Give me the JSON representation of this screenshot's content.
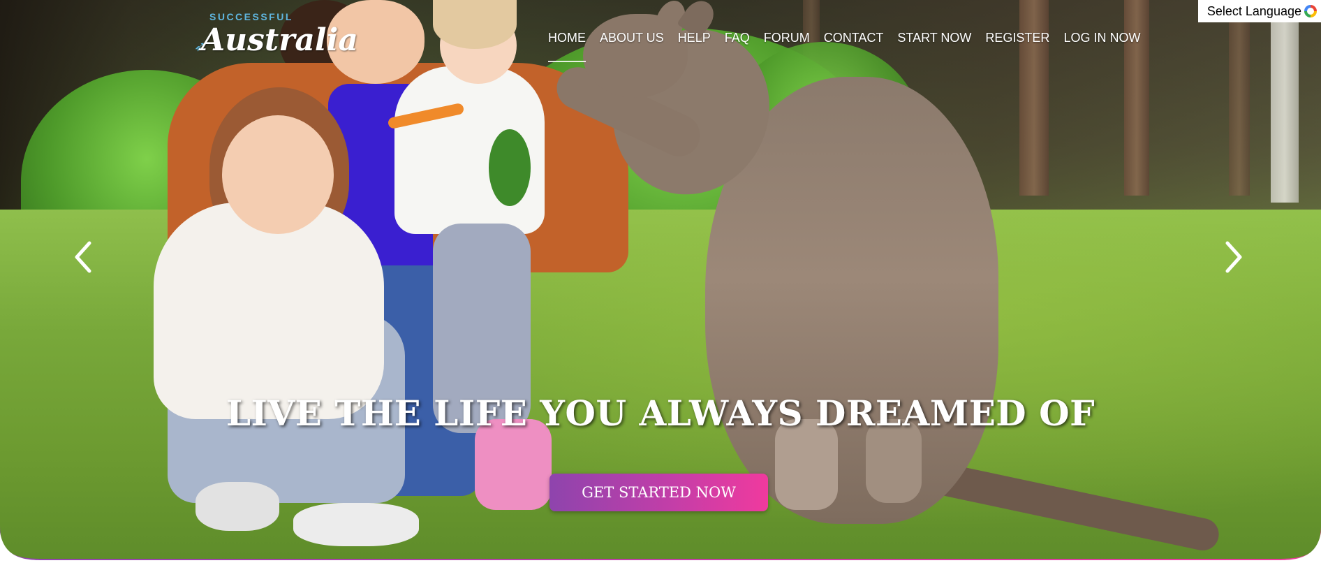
{
  "site": {
    "logo_small": "SUCCESSFUL",
    "logo_main": "Australia"
  },
  "nav": {
    "items": [
      {
        "label": "HOME",
        "active": true
      },
      {
        "label": "ABOUT US"
      },
      {
        "label": "HELP"
      },
      {
        "label": "FAQ"
      },
      {
        "label": "FORUM"
      },
      {
        "label": "CONTACT"
      },
      {
        "label": "START NOW"
      },
      {
        "label": "REGISTER"
      },
      {
        "label": "LOG IN NOW"
      }
    ]
  },
  "language": {
    "label": "Select Language",
    "icon": "google-icon"
  },
  "hero": {
    "headline": "LIVE THE LIFE YOU ALWAYS DREAMED OF",
    "cta_label": "GET STARTED NOW",
    "prev_icon": "chevron-left-icon",
    "next_icon": "chevron-right-icon"
  },
  "colors": {
    "cta_gradient_start": "#8e44ad",
    "cta_gradient_end": "#f03a9e",
    "logo_accent": "#5fb6e0",
    "nav_text": "#ffffff"
  }
}
